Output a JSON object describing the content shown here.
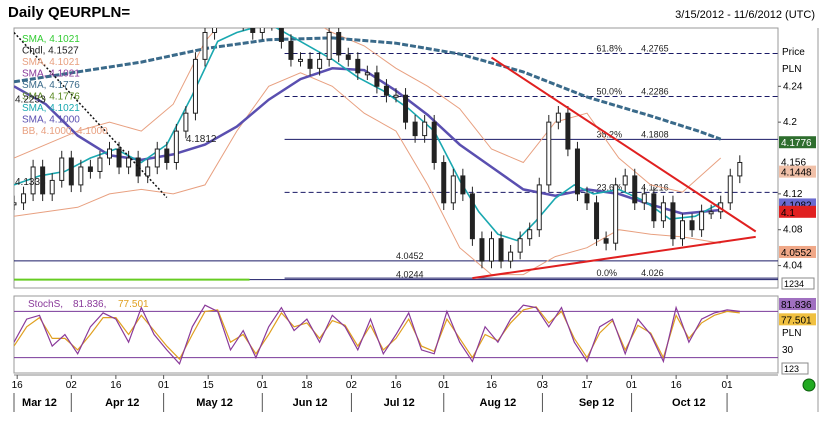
{
  "header": {
    "title": "Daily QEURPLN=",
    "date_range": "3/15/2012 - 11/6/2012 (UTC)"
  },
  "colors": {
    "price": "#222222",
    "sma_fast": "#1aa8b0",
    "sma_mid": "#5a4fb0",
    "sma_slow": "#3a6a8a",
    "bollinger": "#e8a080",
    "trend": "#e02020",
    "fib": "#1a1a66",
    "stoch_k": "#8a3a9a",
    "stoch_d": "#e0a020",
    "green_line": "#66cc22"
  },
  "chart_data": [
    {
      "type": "line",
      "panel": "price",
      "ylabel_top": "Price",
      "ylabel_unit": "PLN",
      "y_ticks": [
        {
          "value": 4.04,
          "label": "4.04"
        },
        {
          "value": 4.08,
          "label": "4.08"
        },
        {
          "value": 4.12,
          "label": "4.12"
        },
        {
          "value": 4.2,
          "label": "4.2"
        },
        {
          "value": 4.24,
          "label": "4.24"
        }
      ],
      "ylim": [
        4.015,
        4.305
      ],
      "x_ticks": [
        {
          "day": 1,
          "label": "16"
        },
        {
          "day": 18,
          "label": "02"
        },
        {
          "day": 32,
          "label": "16"
        },
        {
          "day": 47,
          "label": "01"
        },
        {
          "day": 61,
          "label": "15"
        },
        {
          "day": 78,
          "label": "01"
        },
        {
          "day": 92,
          "label": "18"
        },
        {
          "day": 106,
          "label": "02"
        },
        {
          "day": 120,
          "label": "16"
        },
        {
          "day": 135,
          "label": "01"
        },
        {
          "day": 150,
          "label": "16"
        },
        {
          "day": 166,
          "label": "03"
        },
        {
          "day": 180,
          "label": "17"
        },
        {
          "day": 194,
          "label": "01"
        },
        {
          "day": 208,
          "label": "16"
        },
        {
          "day": 224,
          "label": "01"
        }
      ],
      "month_labels": [
        {
          "day": 8,
          "label": "Mar 12"
        },
        {
          "day": 34,
          "label": "Apr 12"
        },
        {
          "day": 63,
          "label": "May 12"
        },
        {
          "day": 93,
          "label": "Jun 12"
        },
        {
          "day": 121,
          "label": "Jul 12"
        },
        {
          "day": 152,
          "label": "Aug 12"
        },
        {
          "day": 183,
          "label": "Sep 12"
        },
        {
          "day": 212,
          "label": "Oct 12"
        }
      ],
      "legend": [
        {
          "text": "SMA, 4.1021",
          "color": "#33cc33"
        },
        {
          "text": "Chdl, 4.1527",
          "color": "#222222"
        },
        {
          "text": "SMA, 4.1021",
          "color": "#e8a080"
        },
        {
          "text": "SMA, 4.1021",
          "color": "#8a3a9a"
        },
        {
          "text": "SMA, 4.1776",
          "color": "#3a6a8a"
        },
        {
          "text": "SMA, 4.1776",
          "color": "#5a8a22"
        },
        {
          "text": "SMA, 4.1021",
          "color": "#1aa8b0"
        },
        {
          "text": "SMA, 4.1000",
          "color": "#5a4fb0"
        },
        {
          "text": "BB, 4.1000, 4.1000",
          "color": "#e8a080"
        }
      ],
      "legend_extra": [
        {
          "text": "4.2253",
          "value": 4.2253
        },
        {
          "text": "4.1333",
          "value": 4.1333
        }
      ],
      "fib_levels": [
        {
          "label": "61.8%",
          "value_text": "4.2765",
          "value": 4.2765,
          "style": "dashed"
        },
        {
          "label": "50.0%",
          "value_text": "4.2286",
          "value": 4.2286,
          "style": "dashed"
        },
        {
          "label": "38.2%",
          "value_text": "4.1808",
          "value": 4.1808,
          "style": "solid"
        },
        {
          "label": "23.6%",
          "value_text": "4.1216",
          "value": 4.1216,
          "style": "dashed"
        },
        {
          "label": "0.0%",
          "value_text": "4.026",
          "value": 4.026,
          "style": "solid"
        }
      ],
      "hlines": [
        {
          "value_text": "4.0452",
          "value": 4.0452
        },
        {
          "value_text": "4.0244",
          "value": 4.0244
        }
      ],
      "mid_label": {
        "text": "4.1812",
        "value": 4.1812,
        "day": 54
      },
      "right_labels": [
        {
          "text": "4.1776",
          "value": 4.1776,
          "bg": "#2e6e2e",
          "fg": "#ffffff"
        },
        {
          "text": "4.156",
          "value": 4.156,
          "bg": "#ffffff",
          "fg": "#000000"
        },
        {
          "text": "4.1448",
          "value": 4.1448,
          "bg": "#f0c0a8",
          "fg": "#000000"
        },
        {
          "text": "4.1082",
          "value": 4.1082,
          "bg": "#6a6ad0",
          "fg": "#000000"
        },
        {
          "text": "4.1",
          "value": 4.1,
          "bg": "#e02020",
          "fg": "#000000"
        },
        {
          "text": "4.0552",
          "value": 4.0552,
          "bg": "#f0a888",
          "fg": "#000000"
        }
      ],
      "time_code": "1234",
      "trend_lines": [
        {
          "from": [
            144,
            4.026
          ],
          "to": [
            233,
            4.072
          ]
        },
        {
          "from": [
            150,
            4.272
          ],
          "to": [
            233,
            4.078
          ]
        },
        {
          "from": [
            0,
            4.3
          ],
          "to": [
            48,
            4.116
          ]
        }
      ],
      "series": [
        {
          "name": "SMA",
          "role": "sma_slow",
          "x": [
            0,
            20,
            40,
            60,
            80,
            100,
            120,
            140,
            160,
            180,
            200,
            215,
            222
          ],
          "values": [
            4.245,
            4.256,
            4.267,
            4.282,
            4.292,
            4.294,
            4.288,
            4.276,
            4.256,
            4.228,
            4.207,
            4.19,
            4.181
          ]
        },
        {
          "name": "SMA",
          "role": "sma_mid",
          "x": [
            0,
            10,
            20,
            30,
            40,
            50,
            60,
            70,
            80,
            90,
            100,
            110,
            120,
            130,
            140,
            150,
            160,
            170,
            180,
            190,
            200,
            210,
            222
          ],
          "values": [
            4.24,
            4.22,
            4.185,
            4.163,
            4.158,
            4.164,
            4.175,
            4.195,
            4.225,
            4.248,
            4.26,
            4.258,
            4.235,
            4.208,
            4.175,
            4.15,
            4.125,
            4.118,
            4.125,
            4.12,
            4.108,
            4.098,
            4.102
          ]
        },
        {
          "name": "SMA",
          "role": "sma_fast",
          "x": [
            0,
            8,
            16,
            24,
            32,
            40,
            48,
            56,
            64,
            70,
            80,
            90,
            100,
            108,
            116,
            124,
            132,
            140,
            146,
            152,
            158,
            164,
            170,
            176,
            182,
            190,
            198,
            206,
            214,
            222
          ],
          "values": [
            4.13,
            4.14,
            4.145,
            4.16,
            4.17,
            4.155,
            4.175,
            4.23,
            4.29,
            4.3,
            4.31,
            4.29,
            4.27,
            4.25,
            4.235,
            4.215,
            4.19,
            4.135,
            4.1,
            4.075,
            4.068,
            4.09,
            4.115,
            4.13,
            4.12,
            4.125,
            4.112,
            4.092,
            4.095,
            4.11
          ]
        },
        {
          "name": "BB",
          "role": "bb_upper",
          "x": [
            0,
            10,
            20,
            30,
            40,
            50,
            60,
            70,
            80,
            90,
            100,
            110,
            120,
            130,
            140,
            150,
            160,
            170,
            180,
            190,
            200,
            210,
            222
          ],
          "values": [
            4.16,
            4.175,
            4.19,
            4.2,
            4.19,
            4.22,
            4.29,
            4.33,
            4.34,
            4.32,
            4.3,
            4.285,
            4.26,
            4.24,
            4.215,
            4.17,
            4.155,
            4.2,
            4.21,
            4.16,
            4.13,
            4.122,
            4.16
          ]
        },
        {
          "name": "BB",
          "role": "bb_lower",
          "x": [
            0,
            10,
            20,
            30,
            40,
            50,
            60,
            70,
            80,
            90,
            100,
            110,
            120,
            130,
            140,
            150,
            160,
            170,
            180,
            190,
            200,
            210,
            222
          ],
          "values": [
            4.095,
            4.1,
            4.105,
            4.12,
            4.125,
            4.12,
            4.13,
            4.19,
            4.24,
            4.255,
            4.24,
            4.21,
            4.19,
            4.13,
            4.06,
            4.03,
            4.03,
            4.05,
            4.06,
            4.08,
            4.075,
            4.072,
            4.065
          ]
        },
        {
          "name": "Close",
          "role": "price",
          "x": [
            0,
            3,
            6,
            9,
            12,
            15,
            18,
            21,
            24,
            27,
            30,
            33,
            36,
            39,
            42,
            45,
            48,
            51,
            54,
            57,
            60,
            63,
            66,
            69,
            72,
            75,
            78,
            81,
            84,
            87,
            90,
            93,
            96,
            99,
            102,
            105,
            108,
            111,
            114,
            117,
            120,
            123,
            126,
            129,
            132,
            135,
            138,
            141,
            144,
            147,
            150,
            153,
            156,
            159,
            162,
            165,
            168,
            171,
            174,
            177,
            180,
            183,
            186,
            189,
            192,
            195,
            198,
            201,
            204,
            207,
            210,
            213,
            216,
            219,
            222,
            225,
            228
          ],
          "values": [
            4.11,
            4.12,
            4.15,
            4.12,
            4.135,
            4.16,
            4.13,
            4.15,
            4.145,
            4.16,
            4.17,
            4.15,
            4.16,
            4.14,
            4.15,
            4.17,
            4.155,
            4.19,
            4.21,
            4.27,
            4.3,
            4.33,
            4.34,
            4.33,
            4.31,
            4.3,
            4.33,
            4.31,
            4.29,
            4.27,
            4.27,
            4.26,
            4.27,
            4.3,
            4.275,
            4.27,
            4.255,
            4.255,
            4.24,
            4.23,
            4.23,
            4.2,
            4.185,
            4.2,
            4.155,
            4.11,
            4.14,
            4.12,
            4.07,
            4.045,
            4.07,
            4.045,
            4.055,
            4.07,
            4.08,
            4.13,
            4.2,
            4.21,
            4.17,
            4.12,
            4.11,
            4.07,
            4.065,
            4.13,
            4.14,
            4.11,
            4.12,
            4.09,
            4.11,
            4.07,
            4.09,
            4.08,
            4.1,
            4.1,
            4.11,
            4.14,
            4.155
          ]
        }
      ]
    },
    {
      "type": "line",
      "panel": "stochastic",
      "legend": [
        {
          "text": "StochS,",
          "color": "#8a3a9a"
        },
        {
          "text": "81.836,",
          "color": "#8a3a9a"
        },
        {
          "text": "77.501",
          "color": "#e0a020"
        }
      ],
      "ylabel_unit": "PLN",
      "y_ticks": [
        {
          "value": 30,
          "label": "30"
        }
      ],
      "ylim": [
        0,
        100
      ],
      "hlines": [
        80,
        20
      ],
      "right_labels": [
        {
          "text": "81.836",
          "value": 81.836,
          "bg": "#a070c0",
          "fg": "#000000"
        },
        {
          "text": "77.501",
          "value": 77.501,
          "bg": "#f0c040",
          "fg": "#000000"
        }
      ],
      "time_code": "123",
      "series": [
        {
          "name": "StochS",
          "role": "stoch_k",
          "x": [
            0,
            4,
            8,
            12,
            16,
            20,
            24,
            28,
            32,
            36,
            40,
            44,
            48,
            52,
            56,
            60,
            64,
            68,
            72,
            76,
            80,
            84,
            88,
            92,
            96,
            100,
            104,
            108,
            112,
            116,
            120,
            124,
            128,
            132,
            136,
            140,
            144,
            148,
            152,
            156,
            160,
            164,
            168,
            172,
            176,
            180,
            184,
            188,
            192,
            196,
            200,
            204,
            208,
            212,
            216,
            220,
            224,
            228
          ],
          "values": [
            40,
            70,
            75,
            35,
            50,
            25,
            60,
            78,
            70,
            40,
            85,
            50,
            30,
            12,
            60,
            88,
            80,
            30,
            55,
            20,
            60,
            85,
            55,
            70,
            40,
            75,
            60,
            30,
            70,
            25,
            50,
            78,
            30,
            25,
            80,
            40,
            15,
            60,
            40,
            70,
            88,
            85,
            60,
            85,
            40,
            15,
            60,
            70,
            25,
            70,
            50,
            15,
            85,
            40,
            70,
            78,
            82,
            80
          ]
        },
        {
          "name": "StochS",
          "role": "stoch_d",
          "x": [
            0,
            4,
            8,
            12,
            16,
            20,
            24,
            28,
            32,
            36,
            40,
            44,
            48,
            52,
            56,
            60,
            64,
            68,
            72,
            76,
            80,
            84,
            88,
            92,
            96,
            100,
            104,
            108,
            112,
            116,
            120,
            124,
            128,
            132,
            136,
            140,
            144,
            148,
            152,
            156,
            160,
            164,
            168,
            172,
            176,
            180,
            184,
            188,
            192,
            196,
            200,
            204,
            208,
            212,
            216,
            220,
            224,
            228
          ],
          "values": [
            35,
            60,
            72,
            45,
            45,
            30,
            50,
            72,
            72,
            50,
            75,
            55,
            35,
            18,
            50,
            80,
            82,
            40,
            50,
            25,
            50,
            78,
            60,
            65,
            45,
            68,
            62,
            35,
            62,
            30,
            45,
            70,
            35,
            28,
            70,
            45,
            20,
            50,
            42,
            65,
            82,
            86,
            65,
            80,
            45,
            20,
            52,
            68,
            30,
            62,
            52,
            20,
            75,
            45,
            65,
            75,
            80,
            78
          ]
        }
      ]
    }
  ]
}
